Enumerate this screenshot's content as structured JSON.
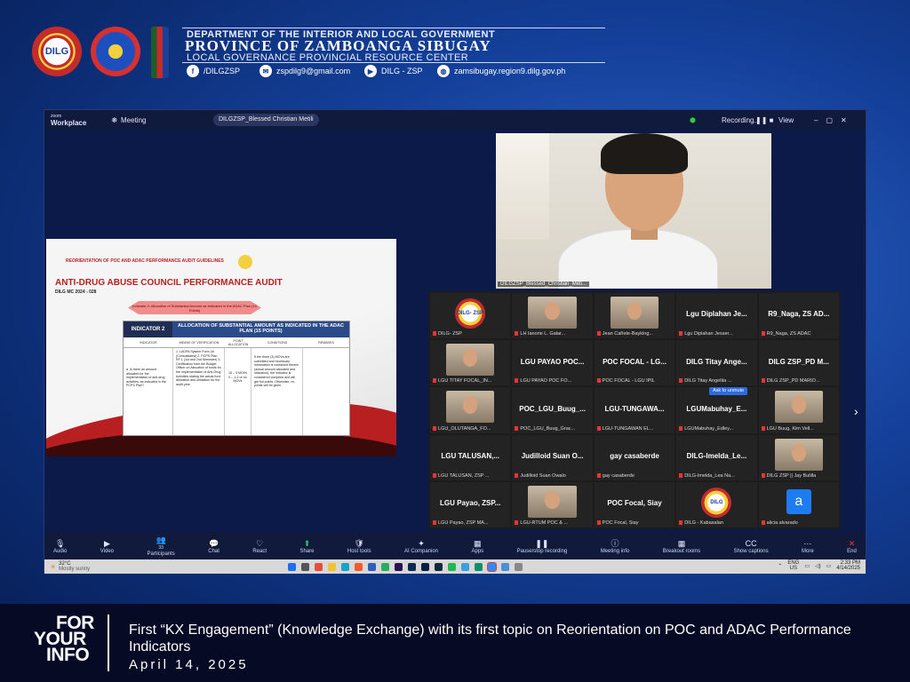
{
  "header": {
    "line1": "DEPARTMENT OF THE INTERIOR AND LOCAL GOVERNMENT",
    "line2": "PROVINCE OF ZAMBOANGA SIBUGAY",
    "line3": "LOCAL GOVERNANCE PROVINCIAL RESOURCE CENTER",
    "logo1": "DILG",
    "contacts": [
      {
        "icon": "facebook-icon",
        "text": "/DILGZSP"
      },
      {
        "icon": "mail-icon",
        "text": "zspdilg9@gmail.com"
      },
      {
        "icon": "youtube-icon",
        "text": "DILG - ZSP"
      },
      {
        "icon": "globe-icon",
        "text": "zamsibugay.region9.dilg.gov.ph"
      }
    ]
  },
  "zoom": {
    "brand_top": "zoom",
    "brand": "Workplace",
    "meeting": "Meeting",
    "active_name": "DILGZSP_Blessed Christian Metili",
    "recording": "Recording...",
    "view": "View",
    "cam_caption": "DILGZSP_Blessed_Christian_Meti..."
  },
  "slide": {
    "title_bar": "REORIENTATION OF POC AND ADAC PERFORMANCE AUDIT GUIDELINES",
    "heading": "ANTI-DRUG ABUSE COUNCIL PERFORMANCE AUDIT",
    "sub": "DILG MC 2024 - 028",
    "pill": "Indicator 2: Allocation of Substantial Amount as Indicated in the ADAC Plan (15 Points)",
    "ind_label": "INDICATOR 2",
    "ind_title": "ALLOCATION OF SUBSTANTIAL AMOUNT AS INDICATED IN THE ADAC PLAN (15 POINTS)",
    "cols": [
      "INDICATOR",
      "MEANS OF VERIFICATION",
      "POINT ALLOCATION",
      "CONDITIONS",
      "REMARKS"
    ],
    "cells": [
      "a. Is there an amount allocated for the implementation of anti-drug activities, as indicated in the PCPS Plan?",
      "1. LADPA System Form 2a (Consolidated) 2. PCPS Plan RF 1 (1st and 2nd Semester) 3. Certification from the Budget Officer on Allocation of funds for the implementation of Anti-Drug Activities stating the actual fund allocation and utilization for the audit year",
      "15 – 3 MOVs\n0 – 1-2 or no MOVs",
      "If the three (3) MOVs are submitted and necessary information is contained therein (actual amount allocated and utilization), the indicator is considered complied and will get full points. Otherwise, no points will be given",
      ""
    ]
  },
  "participants": [
    {
      "kind": "logo",
      "label": "DILG- ZSP",
      "cap": "DILG- ZSP"
    },
    {
      "kind": "person",
      "label": "",
      "cap": "LH Ianorie L. Galar..."
    },
    {
      "kind": "person",
      "label": "",
      "cap": "Jean Cañete-Bayking..."
    },
    {
      "kind": "name",
      "label": "Lgu Diplahan Je...",
      "cap": "Lgu Diplahan Jesser..."
    },
    {
      "kind": "name",
      "label": "R9_Naga, ZS AD...",
      "cap": "R9_Naga, ZS ADAC"
    },
    {
      "kind": "person",
      "label": "",
      "cap": "LGU TITAY FOCAL_IN..."
    },
    {
      "kind": "name",
      "label": "LGU PAYAO POC...",
      "cap": "LGU PAYAO POC FO..."
    },
    {
      "kind": "name",
      "label": "POC FOCAL - LG...",
      "cap": "POC FOCAL - LGU IPIL"
    },
    {
      "kind": "name",
      "label": "DILG Titay Ange...",
      "cap": "DILG Titay Angelita ..."
    },
    {
      "kind": "name",
      "label": "DILG ZSP_PD M...",
      "cap": "DILG ZSP_PD MARIO..."
    },
    {
      "kind": "person",
      "label": "",
      "cap": "LGU_OLUTANGA_FO..."
    },
    {
      "kind": "name",
      "label": "POC_LGU_Buug_...",
      "cap": "POC_LGU_Buug_Grac..."
    },
    {
      "kind": "name",
      "label": "LGU-TUNGAWA...",
      "cap": "LGU-TUNGAWAN EL..."
    },
    {
      "kind": "name",
      "label": "LGUMabuhay_E...",
      "cap": "LGUMabuhay_Edley..."
    },
    {
      "kind": "person",
      "label": "",
      "cap": "LGU Buug, Kim Vell..."
    },
    {
      "kind": "name",
      "label": "LGU TALUSAN,...",
      "cap": "LGU TALUSAN, ZSP ..."
    },
    {
      "kind": "name",
      "label": "Judilloid Suan O...",
      "cap": "Judilloid Suan Owalo"
    },
    {
      "kind": "name",
      "label": "gay casaberde",
      "cap": "gay casaberde"
    },
    {
      "kind": "name",
      "label": "DILG-Imelda_Le...",
      "cap": "DILG-Imelda_Lea Na..."
    },
    {
      "kind": "person",
      "label": "",
      "cap": "DILG ZSP || Jay Bulilla"
    },
    {
      "kind": "name",
      "label": "LGU Payao, ZSP...",
      "cap": "LGU Payao, ZSP MA..."
    },
    {
      "kind": "person",
      "label": "",
      "cap": "LGU-RTUM POC & ..."
    },
    {
      "kind": "name",
      "label": "POC Focal, Siay",
      "cap": "POC Focal, Siay"
    },
    {
      "kind": "logo",
      "label": "DILG",
      "cap": "DILG - Kabasalan"
    },
    {
      "kind": "avatar",
      "label": "a",
      "cap": "alicia alvarado"
    }
  ],
  "ask_btn": "Ask to unmute",
  "toolbar": [
    {
      "icon": "mic-icon",
      "label": "Audio"
    },
    {
      "icon": "video-icon",
      "label": "Video"
    },
    {
      "icon": "participants-icon",
      "label": "Participants",
      "count": "33"
    },
    {
      "icon": "chat-icon",
      "label": "Chat"
    },
    {
      "icon": "react-icon",
      "label": "React"
    },
    {
      "icon": "share-icon",
      "label": "Share"
    },
    {
      "icon": "host-tools-icon",
      "label": "Host tools"
    },
    {
      "icon": "ai-companion-icon",
      "label": "AI Companion"
    },
    {
      "icon": "apps-icon",
      "label": "Apps"
    },
    {
      "icon": "pause-icon",
      "label": "Pause/stop recording"
    },
    {
      "icon": "info-icon",
      "label": "Meeting info"
    },
    {
      "icon": "breakout-icon",
      "label": "Breakout rooms"
    },
    {
      "icon": "captions-icon",
      "label": "Show captions"
    },
    {
      "icon": "more-icon",
      "label": "More"
    },
    {
      "icon": "end-icon",
      "label": "End"
    }
  ],
  "taskbar": {
    "weather_temp": "32°C",
    "weather_desc": "Mostly sunny",
    "lang": "ENG",
    "region": "US",
    "time": "2:33 PM",
    "date": "4/14/2025"
  },
  "footer": {
    "fyi": [
      "FOR",
      "YOUR",
      "INFO"
    ],
    "caption": "First “KX Engagement” (Knowledge Exchange) with its first topic on Reorientation on POC and ADAC Performance Indicators",
    "date": "April 14, 2025"
  },
  "colors": {
    "bg": "#14409a",
    "footer": "#070a24",
    "slide_red": "#c4282a",
    "zoom_bg": "#0d1b4a"
  }
}
